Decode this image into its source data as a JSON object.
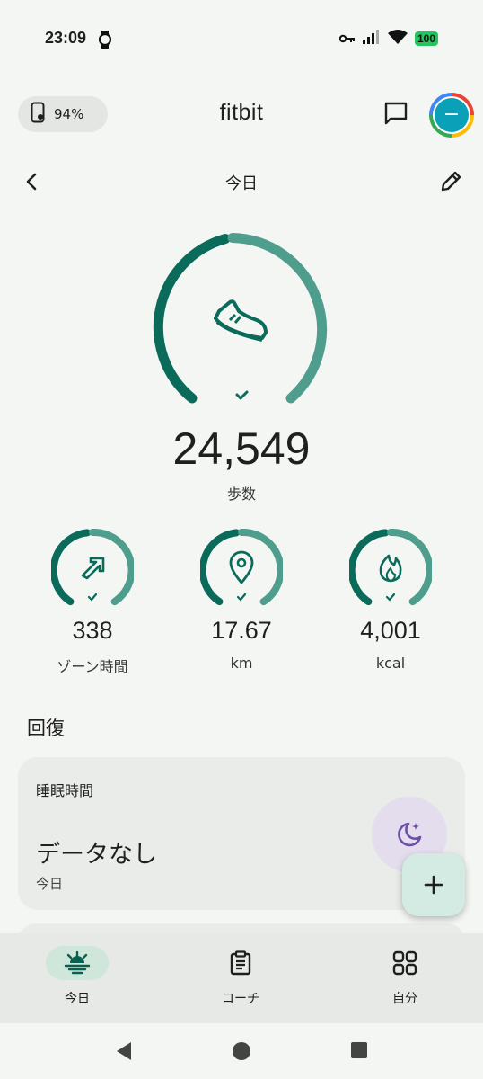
{
  "status_bar": {
    "time": "23:09",
    "battery": "100",
    "icons": [
      "watch-icon",
      "key-icon",
      "signal-icon",
      "wifi-icon",
      "battery-icon"
    ]
  },
  "header": {
    "device_battery": "94%",
    "app_title": "fitbit",
    "avatar_initial": "−"
  },
  "navigation": {
    "date_title": "今日"
  },
  "steps": {
    "value": "24,549",
    "label": "歩数",
    "goal_reached": true
  },
  "stats": [
    {
      "value": "338",
      "label": "ゾーン時間",
      "icon": "zone-arrow-icon",
      "goal_reached": true
    },
    {
      "value": "17.67",
      "label": "km",
      "icon": "location-pin-icon",
      "goal_reached": true
    },
    {
      "value": "4,001",
      "label": "kcal",
      "icon": "flame-icon",
      "goal_reached": true
    }
  ],
  "recovery": {
    "section_title": "回復",
    "sleep_card": {
      "title": "睡眠時間",
      "value": "データなし",
      "subtitle": "今日"
    }
  },
  "bottom_nav": {
    "items": [
      {
        "label": "今日",
        "icon": "sunrise-icon",
        "active": true
      },
      {
        "label": "コーチ",
        "icon": "clipboard-icon",
        "active": false
      },
      {
        "label": "自分",
        "icon": "grid-icon",
        "active": false
      }
    ]
  },
  "colors": {
    "ring_dark": "#0b6b5a",
    "ring_light": "#4f9e8d",
    "background": "#f4f6f3",
    "card": "#e9ece8",
    "sleep_accent": "#6b4fa8"
  }
}
